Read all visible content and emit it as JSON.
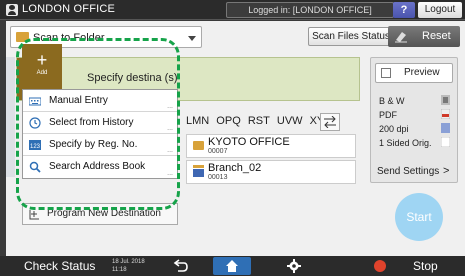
{
  "top_bar": {
    "title": "LONDON OFFICE",
    "login_status": "Logged in: [LONDON OFFICE]",
    "help_label": "?",
    "logout_label": "Logout"
  },
  "scan_folder": {
    "label": "Scan to Folder"
  },
  "scan_files_status_label": "Scan Files Status",
  "reset_label": "Reset",
  "destination": {
    "add_label": "Add",
    "add_symbol": "+",
    "specify_text": "Specify destina     (s)"
  },
  "alpha_tabs": [
    "LMN",
    "OPQ",
    "RST",
    "UVW",
    "XYZ"
  ],
  "destinations": [
    {
      "name": "KYOTO OFFICE",
      "number": "00007"
    },
    {
      "name": "Branch_02",
      "number": "00013"
    }
  ],
  "popup_menu": {
    "items": [
      {
        "label": "Manual Entry",
        "icon": "keyboard-icon"
      },
      {
        "label": "Select from History",
        "icon": "history-icon"
      },
      {
        "label": "Specify by Reg. No.",
        "icon": "number-icon"
      },
      {
        "label": "Search Address Book",
        "icon": "search-icon"
      }
    ],
    "program_label": "Program New Destination"
  },
  "right_panel": {
    "preview_label": "Preview",
    "settings": [
      "B & W",
      "PDF",
      "200 dpi",
      "1 Sided Orig."
    ],
    "send_settings_label": "Send Settings",
    "send_settings_arrow": ">"
  },
  "start_label": "Start",
  "bottom_bar": {
    "check_status_label": "Check Status",
    "date": "18 Jul. 2018",
    "time": "11:18",
    "stop_label": "Stop"
  },
  "colors": {
    "highlight_dash": "#16a34a",
    "add_block": "#8b6a1f",
    "home_button": "#2f6fb5",
    "start_button": "#9fd5f3"
  }
}
